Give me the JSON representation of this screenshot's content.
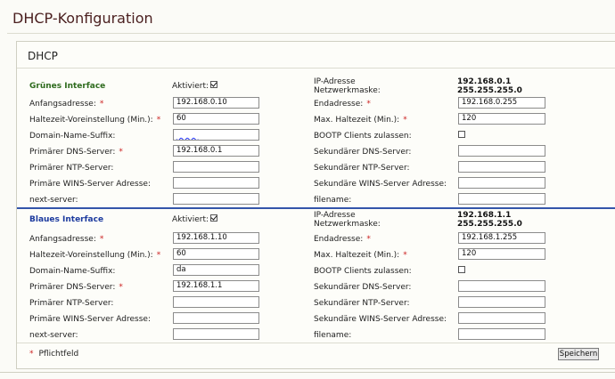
{
  "page_title": "DHCP-Konfiguration",
  "box_title": "DHCP",
  "required_mark": "*",
  "sections": {
    "green": {
      "title": "Grünes Interface",
      "enabled_label": "Aktiviert:",
      "enabled": true,
      "ip_label": "IP-Adresse",
      "ip": "192.168.0.1",
      "netmask_label": "Netzwerkmaske:",
      "netmask": "255.255.255.0",
      "start_label": "Anfangsadresse:",
      "start": "192.168.0.10",
      "end_label": "Endadresse:",
      "end": "192.168.0.255",
      "default_lease_label": "Haltezeit-Voreinstellung (Min.):",
      "default_lease": "60",
      "max_lease_label": "Max. Haltezeit (Min.):",
      "max_lease": "120",
      "domain_label": "Domain-Name-Suffix:",
      "domain": "",
      "bootp_label": "BOOTP Clients zulassen:",
      "bootp": false,
      "dns1_label": "Primärer DNS-Server:",
      "dns1": "192.168.0.1",
      "dns2_label": "Sekundärer DNS-Server:",
      "dns2": "",
      "ntp1_label": "Primärer NTP-Server:",
      "ntp1": "",
      "ntp2_label": "Sekundärer NTP-Server:",
      "ntp2": "",
      "wins1_label": "Primäre WINS-Server Adresse:",
      "wins1": "",
      "wins2_label": "Sekundäre WINS-Server Adresse:",
      "wins2": "",
      "next_server_label": "next-server:",
      "next_server": "",
      "filename_label": "filename:",
      "filename": ""
    },
    "blue": {
      "title": "Blaues Interface",
      "enabled_label": "Aktiviert:",
      "enabled": true,
      "ip_label": "IP-Adresse",
      "ip": "192.168.1.1",
      "netmask_label": "Netzwerkmaske:",
      "netmask": "255.255.255.0",
      "start_label": "Anfangsadresse:",
      "start": "192.168.1.10",
      "end_label": "Endadresse:",
      "end": "192.168.1.255",
      "default_lease_label": "Haltezeit-Voreinstellung (Min.):",
      "default_lease": "60",
      "max_lease_label": "Max. Haltezeit (Min.):",
      "max_lease": "120",
      "domain_label": "Domain-Name-Suffix:",
      "domain": "da",
      "bootp_label": "BOOTP Clients zulassen:",
      "bootp": false,
      "dns1_label": "Primärer DNS-Server:",
      "dns1": "192.168.1.1",
      "dns2_label": "Sekundärer DNS-Server:",
      "dns2": "",
      "ntp1_label": "Primärer NTP-Server:",
      "ntp1": "",
      "ntp2_label": "Sekundärer NTP-Server:",
      "ntp2": "",
      "wins1_label": "Primäre WINS-Server Adresse:",
      "wins1": "",
      "wins2_label": "Sekundäre WINS-Server Adresse:",
      "wins2": "",
      "next_server_label": "next-server:",
      "next_server": "",
      "filename_label": "filename:",
      "filename": ""
    }
  },
  "footer": {
    "required_note": "Pflichtfeld",
    "save_label": "Speichern"
  },
  "colors": {
    "title": "#4a1f1f",
    "green_heading": "#2e6b1e",
    "blue_heading": "#1c3a9e",
    "required": "#cc2222",
    "divider": "#3355aa"
  }
}
